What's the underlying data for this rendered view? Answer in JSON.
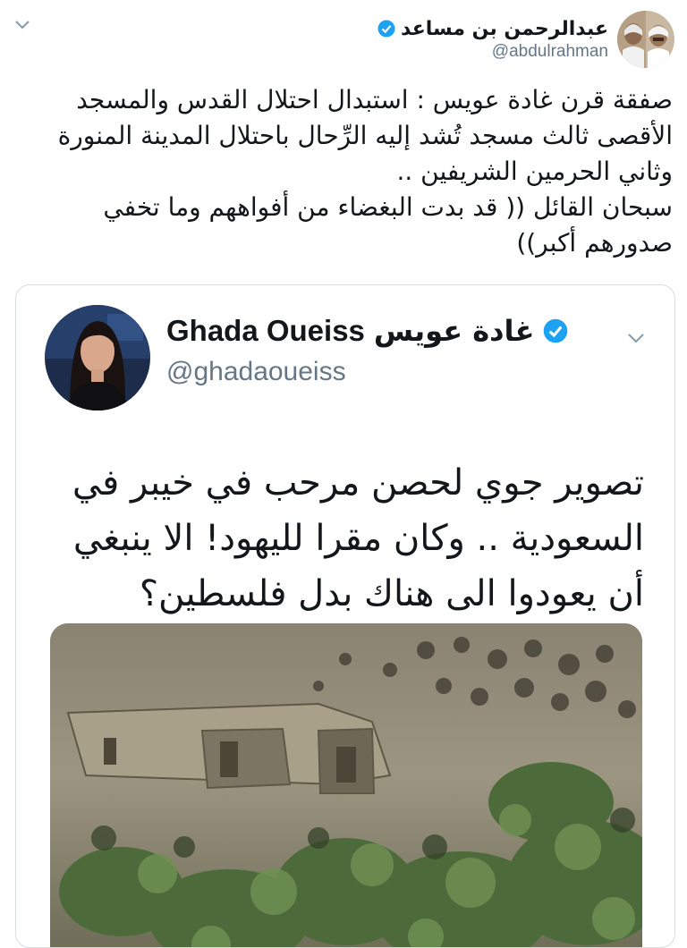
{
  "tweet": {
    "author": {
      "display_name": "عبدالرحمن بن مساعد",
      "handle": "@abdulrahman",
      "verified": true,
      "avatar_icon": "avatar-photo"
    },
    "menu_icon": "chevron-down-icon",
    "text": "صفقة قرن غادة عويس : استبدال احتلال القدس والمسجد الأقصى ثالث مسجد تُشد إليه الرِّحال باحتلال المدينة المنورة وثاني الحرمين الشريفين ..\nسبحان القائل (( قد بدت البغضاء من أفواههم وما تخفي صدورهم أكبر))"
  },
  "quoted_tweet": {
    "author": {
      "display_name_en": "Ghada Oueiss",
      "display_name_ar": "غادة عويس",
      "handle": "@ghadaoueiss",
      "verified": true,
      "avatar_icon": "avatar-photo"
    },
    "menu_icon": "chevron-down-icon",
    "text": "تصوير جوي لحصن مرحب في خيبر في السعودية .. وكان مقرا لليهود! الا ينبغي أن يعودوا الى هناك بدل فلسطين؟",
    "media": {
      "kind": "aerial-photo",
      "icon": "image-thumbnail"
    }
  },
  "colors": {
    "text": "#14171a",
    "secondary": "#657786",
    "verified": "#1da1f2",
    "border": "#d7dde2"
  }
}
